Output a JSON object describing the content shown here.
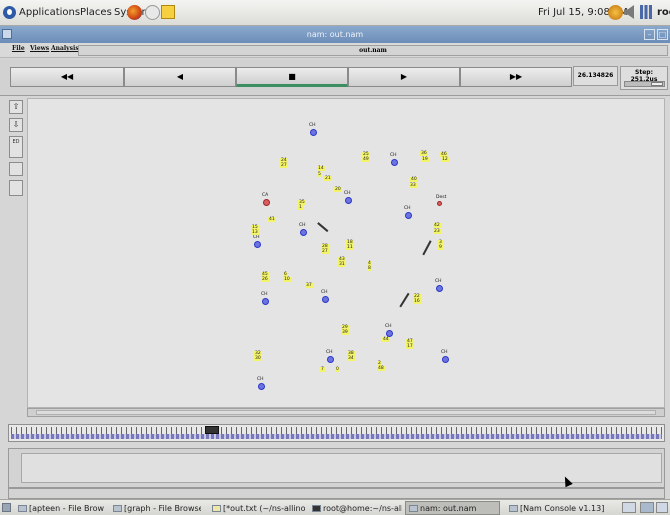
{
  "top_panel": {
    "menus": [
      "Applications",
      "Places",
      "System"
    ],
    "clock": "Fri Jul 15,  9:08 PM",
    "user": "roo",
    "icons": [
      "ubuntu-logo-icon",
      "firefox-icon",
      "help-icon",
      "notes-icon",
      "network-icon",
      "volume-icon",
      "chart-icon"
    ]
  },
  "window": {
    "title": "nam: out.nam",
    "menus": [
      "File",
      "Views",
      "Analysis"
    ],
    "file_label": "out.nam"
  },
  "controls": {
    "rewind": "◀◀",
    "back": "◀",
    "stop": "■",
    "play": "▶",
    "fast_forward": "▶▶",
    "time": "26.134826",
    "step": "Step: 251.2us"
  },
  "left_tools": [
    "⇧",
    "⇩",
    "ED",
    "",
    ""
  ],
  "network": {
    "nodes": [
      {
        "label": "CH",
        "color": "blue"
      },
      {
        "label": "CH",
        "color": "blue"
      },
      {
        "label": "CH",
        "color": "blue"
      },
      {
        "label": "CA",
        "color": "red"
      },
      {
        "label": "CH",
        "color": "blue"
      },
      {
        "label": "CH",
        "color": "blue"
      },
      {
        "label": "CH",
        "color": "blue"
      },
      {
        "label": "CH",
        "color": "blue"
      },
      {
        "label": "CH",
        "color": "blue"
      },
      {
        "label": "CH",
        "color": "blue"
      },
      {
        "label": "CH",
        "color": "blue"
      },
      {
        "label": "CH",
        "color": "blue"
      },
      {
        "label": "CH",
        "color": "blue"
      },
      {
        "label": "CH",
        "color": "blue"
      },
      {
        "label": "Dest",
        "color": "red"
      }
    ],
    "numeric_labels": [
      "24",
      "27",
      "14",
      "5",
      "21",
      "20",
      "35",
      "25",
      "49",
      "36",
      "40",
      "19",
      "46",
      "33",
      "12",
      "41",
      "15",
      "1",
      "13",
      "28",
      "27",
      "18",
      "11",
      "4",
      "8",
      "43",
      "31",
      "42",
      "23",
      "3",
      "9",
      "45",
      "26",
      "6",
      "10",
      "37",
      "22",
      "16",
      "29",
      "39",
      "44",
      "47",
      "17",
      "32",
      "30",
      "38",
      "34",
      "2",
      "48",
      "7",
      "0"
    ]
  },
  "taskbar": {
    "tasks": [
      "[apteen - File Browser]",
      "[graph - File Browser]",
      "[*out.txt (~/ns-allinon...",
      "root@home:~/ns-allin...",
      "nam: out.nam",
      "[Nam Console v1.13]"
    ]
  }
}
